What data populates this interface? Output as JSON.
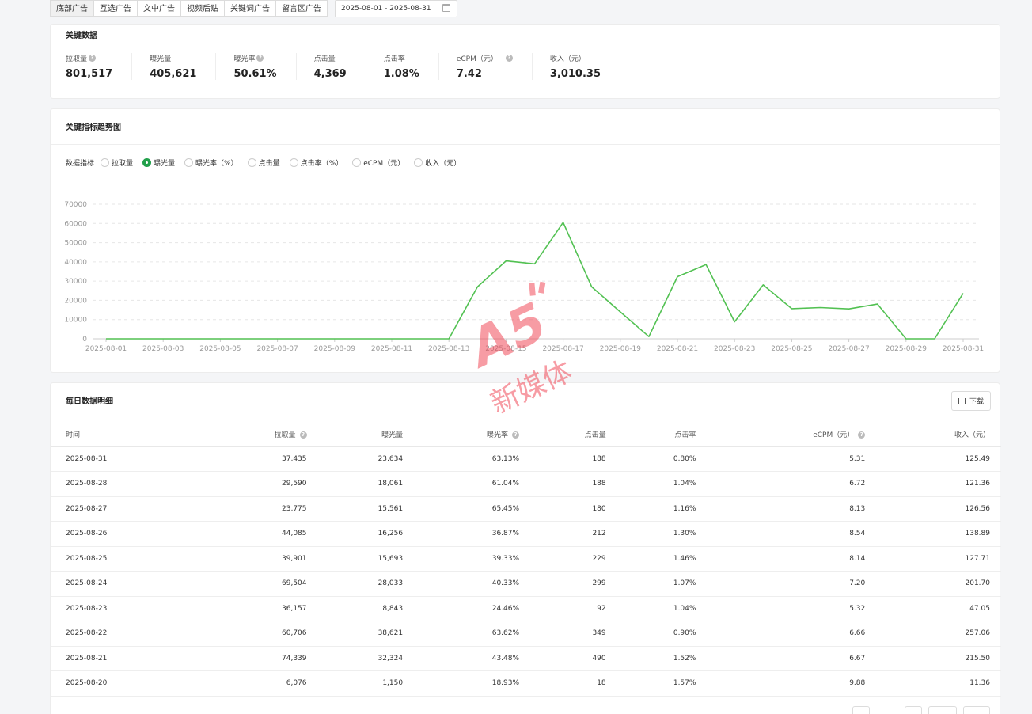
{
  "tabs": [
    "底部广告",
    "互选广告",
    "文中广告",
    "视频后贴",
    "关键词广告",
    "留言区广告"
  ],
  "date_range": "2025-08-01 - 2025-08-31",
  "key_data": {
    "title": "关键数据",
    "metrics": [
      {
        "label": "拉取量",
        "value": "801,517",
        "help": true
      },
      {
        "label": "曝光量",
        "value": "405,621",
        "help": false
      },
      {
        "label": "曝光率",
        "value": "50.61%",
        "help": true
      },
      {
        "label": "点击量",
        "value": "4,369",
        "help": false
      },
      {
        "label": "点击率",
        "value": "1.08%",
        "help": false
      },
      {
        "label": "eCPM（元）",
        "value": "7.42",
        "help": true
      },
      {
        "label": "收入（元）",
        "value": "3,010.35",
        "help": false
      }
    ]
  },
  "trend": {
    "title": "关键指标趋势图",
    "metric_label": "数据指标",
    "options": [
      "拉取量",
      "曝光量",
      "曝光率（%）",
      "点击量",
      "点击率（%）",
      "eCPM（元）",
      "收入（元）"
    ],
    "selected": 1
  },
  "chart_data": {
    "type": "line",
    "x": [
      "2025-08-01",
      "2025-08-02",
      "2025-08-03",
      "2025-08-04",
      "2025-08-05",
      "2025-08-06",
      "2025-08-07",
      "2025-08-08",
      "2025-08-09",
      "2025-08-10",
      "2025-08-11",
      "2025-08-12",
      "2025-08-13",
      "2025-08-14",
      "2025-08-15",
      "2025-08-16",
      "2025-08-17",
      "2025-08-18",
      "2025-08-19",
      "2025-08-20",
      "2025-08-21",
      "2025-08-22",
      "2025-08-23",
      "2025-08-24",
      "2025-08-25",
      "2025-08-26",
      "2025-08-27",
      "2025-08-28",
      "2025-08-29",
      "2025-08-30",
      "2025-08-31"
    ],
    "x_tick_labels": [
      "2025-08-01",
      "2025-08-03",
      "2025-08-05",
      "2025-08-07",
      "2025-08-09",
      "2025-08-11",
      "2025-08-13",
      "2025-08-15",
      "2025-08-17",
      "2025-08-19",
      "2025-08-21",
      "2025-08-23",
      "2025-08-25",
      "2025-08-27",
      "2025-08-29",
      "2025-08-31"
    ],
    "series": [
      {
        "values": [
          0,
          0,
          0,
          0,
          0,
          0,
          0,
          0,
          0,
          0,
          0,
          0,
          0,
          27000,
          40500,
          39000,
          60500,
          27000,
          14000,
          1150,
          32324,
          38621,
          8843,
          28033,
          15693,
          16256,
          15561,
          18061,
          0,
          0,
          23634
        ],
        "color": "#52c152"
      }
    ],
    "ylim": [
      0,
      70000
    ],
    "y_ticks": [
      0,
      10000,
      20000,
      30000,
      40000,
      50000,
      60000,
      70000
    ],
    "grid": true
  },
  "daily": {
    "title": "每日数据明细",
    "download_label": "下载",
    "columns": [
      {
        "label": "时间",
        "help": false
      },
      {
        "label": "拉取量",
        "help": true
      },
      {
        "label": "曝光量",
        "help": false
      },
      {
        "label": "曝光率",
        "help": true
      },
      {
        "label": "点击量",
        "help": false
      },
      {
        "label": "点击率",
        "help": false
      },
      {
        "label": "eCPM（元）",
        "help": true
      },
      {
        "label": "收入（元）",
        "help": false
      }
    ],
    "rows": [
      [
        "2025-08-31",
        "37,435",
        "23,634",
        "63.13%",
        "188",
        "0.80%",
        "5.31",
        "125.49"
      ],
      [
        "2025-08-28",
        "29,590",
        "18,061",
        "61.04%",
        "188",
        "1.04%",
        "6.72",
        "121.36"
      ],
      [
        "2025-08-27",
        "23,775",
        "15,561",
        "65.45%",
        "180",
        "1.16%",
        "8.13",
        "126.56"
      ],
      [
        "2025-08-26",
        "44,085",
        "16,256",
        "36.87%",
        "212",
        "1.30%",
        "8.54",
        "138.89"
      ],
      [
        "2025-08-25",
        "39,901",
        "15,693",
        "39.33%",
        "229",
        "1.46%",
        "8.14",
        "127.71"
      ],
      [
        "2025-08-24",
        "69,504",
        "28,033",
        "40.33%",
        "299",
        "1.07%",
        "7.20",
        "201.70"
      ],
      [
        "2025-08-23",
        "36,157",
        "8,843",
        "24.46%",
        "92",
        "1.04%",
        "5.32",
        "47.05"
      ],
      [
        "2025-08-22",
        "60,706",
        "38,621",
        "63.62%",
        "349",
        "0.90%",
        "6.66",
        "257.06"
      ],
      [
        "2025-08-21",
        "74,339",
        "32,324",
        "43.48%",
        "490",
        "1.52%",
        "6.67",
        "215.50"
      ],
      [
        "2025-08-20",
        "6,076",
        "1,150",
        "18.93%",
        "18",
        "1.57%",
        "9.88",
        "11.36"
      ]
    ]
  },
  "watermark": {
    "logo": "A5",
    "text": "新媒体"
  }
}
